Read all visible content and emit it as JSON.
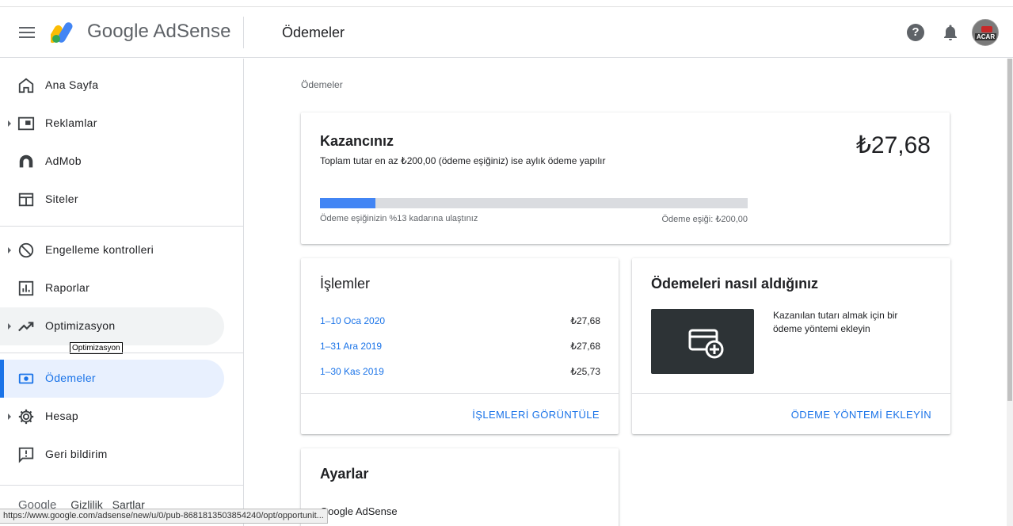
{
  "header": {
    "brand": "Google AdSense",
    "page_title": "Ödemeler",
    "avatar_text": "ACAR"
  },
  "sidebar": {
    "items": [
      {
        "label": "Ana Sayfa",
        "icon": "home-icon"
      },
      {
        "label": "Reklamlar",
        "icon": "ads-icon"
      },
      {
        "label": "AdMob",
        "icon": "admob-icon"
      },
      {
        "label": "Siteler",
        "icon": "sites-icon"
      },
      {
        "label": "Engelleme kontrolleri",
        "icon": "block-icon"
      },
      {
        "label": "Raporlar",
        "icon": "reports-icon"
      },
      {
        "label": "Optimizasyon",
        "icon": "trending-up-icon"
      },
      {
        "label": "Ödemeler",
        "icon": "payments-icon"
      },
      {
        "label": "Hesap",
        "icon": "gear-icon"
      },
      {
        "label": "Geri bildirim",
        "icon": "feedback-icon"
      }
    ],
    "active_item": "Ödemeler",
    "tooltip": "Optimizasyon",
    "footer": {
      "google": "Google",
      "privacy": "Gizlilik",
      "terms": "Şartlar"
    }
  },
  "main": {
    "breadcrumb": "Ödemeler",
    "earnings": {
      "title": "Kazancınız",
      "subtitle": "Toplam tutar en az ₺200,00 (ödeme eşiğiniz) ise aylık ödeme yapılır",
      "amount": "₺27,68",
      "progress_fraction": 0.13,
      "progress_label": "Ödeme eşiğinizin %13 kadarına ulaştınız",
      "threshold_label": "Ödeme eşiği: ₺200,00"
    },
    "transactions": {
      "title": "İşlemler",
      "rows": [
        {
          "date": "1–10 Oca 2020",
          "amount": "₺27,68"
        },
        {
          "date": "1–31 Ara 2019",
          "amount": "₺27,68"
        },
        {
          "date": "1–30 Kas 2019",
          "amount": "₺25,73"
        }
      ],
      "action": "İŞLEMLERİ GÖRÜNTÜLE"
    },
    "payment_method": {
      "title": "Ödemeleri nasıl aldığınız",
      "description": "Kazanılan tutarı almak için bir ödeme yöntemi ekleyin",
      "action": "ÖDEME YÖNTEMİ EKLEYİN"
    },
    "settings": {
      "title": "Ayarlar",
      "line": "Google AdSense"
    }
  },
  "statusbar": {
    "url": "https://www.google.com/adsense/new/u/0/pub-8681813503854240/opt/opportunit..."
  },
  "colors": {
    "accent": "#1a73e8",
    "progress_fill": "#4285f4",
    "active_bg": "#e8f0fe"
  }
}
